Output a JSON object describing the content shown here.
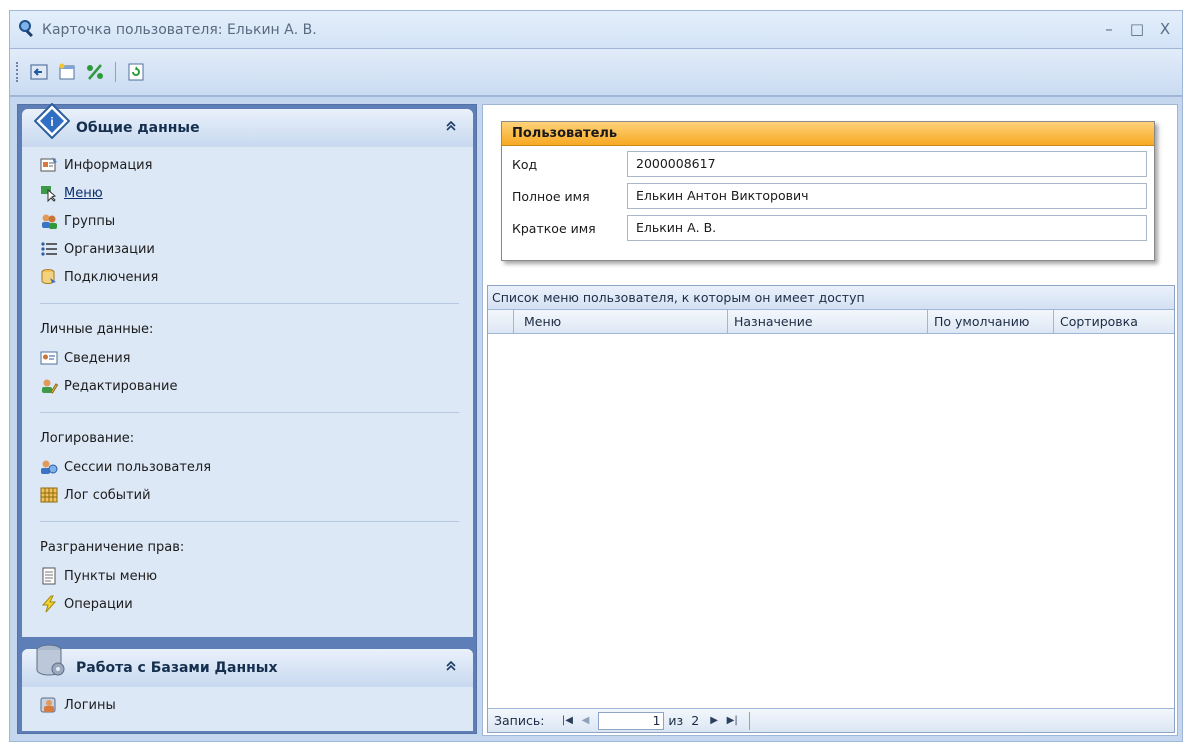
{
  "window": {
    "title": "Карточка пользователя: Елькин А. В.",
    "controls": {
      "minimize": "–",
      "maximize": "□",
      "close": "X"
    }
  },
  "toolbar": {
    "buttons": [
      "back-icon",
      "new-window-icon",
      "percent-icon",
      "refresh-icon"
    ]
  },
  "nav": {
    "group1": {
      "title": "Общие данные",
      "collapse": "⌃",
      "items": [
        {
          "label": "Информация",
          "icon": "info-card-icon"
        },
        {
          "label": "Меню",
          "icon": "menu-cursor-icon"
        },
        {
          "label": "Группы",
          "icon": "groups-icon"
        },
        {
          "label": "Организации",
          "icon": "list-icon"
        },
        {
          "label": "Подключения",
          "icon": "connections-icon"
        }
      ],
      "sections": [
        {
          "label": "Личные данные:",
          "items": [
            {
              "label": "Сведения",
              "icon": "id-card-icon"
            },
            {
              "label": "Редактирование",
              "icon": "user-edit-icon"
            }
          ]
        },
        {
          "label": "Логирование:",
          "items": [
            {
              "label": "Сессии пользователя",
              "icon": "sessions-icon"
            },
            {
              "label": "Лог событий",
              "icon": "event-log-icon"
            }
          ]
        },
        {
          "label": "Разграничение прав:",
          "items": [
            {
              "label": "Пункты меню",
              "icon": "document-icon"
            },
            {
              "label": "Операции",
              "icon": "lightning-icon"
            }
          ]
        }
      ]
    },
    "group2": {
      "title": "Работа с Базами Данных",
      "collapse": "⌃",
      "items": [
        {
          "label": "Логины",
          "icon": "login-user-icon"
        }
      ]
    }
  },
  "user": {
    "header": "Пользователь",
    "fields": [
      {
        "label": "Код",
        "value": "2000008617"
      },
      {
        "label": "Полное имя",
        "value": "Елькин Антон Викторович"
      },
      {
        "label": "Краткое имя",
        "value": "Елькин А. В."
      }
    ]
  },
  "grid": {
    "caption": "Список меню пользователя, к которым он имеет доступ",
    "columns": [
      "Меню",
      "Назначение",
      "По умолчанию",
      "Сортировка"
    ],
    "rows": [],
    "footer": {
      "label": "Запись:",
      "page": "1",
      "of_label": "из",
      "total": "2"
    }
  }
}
